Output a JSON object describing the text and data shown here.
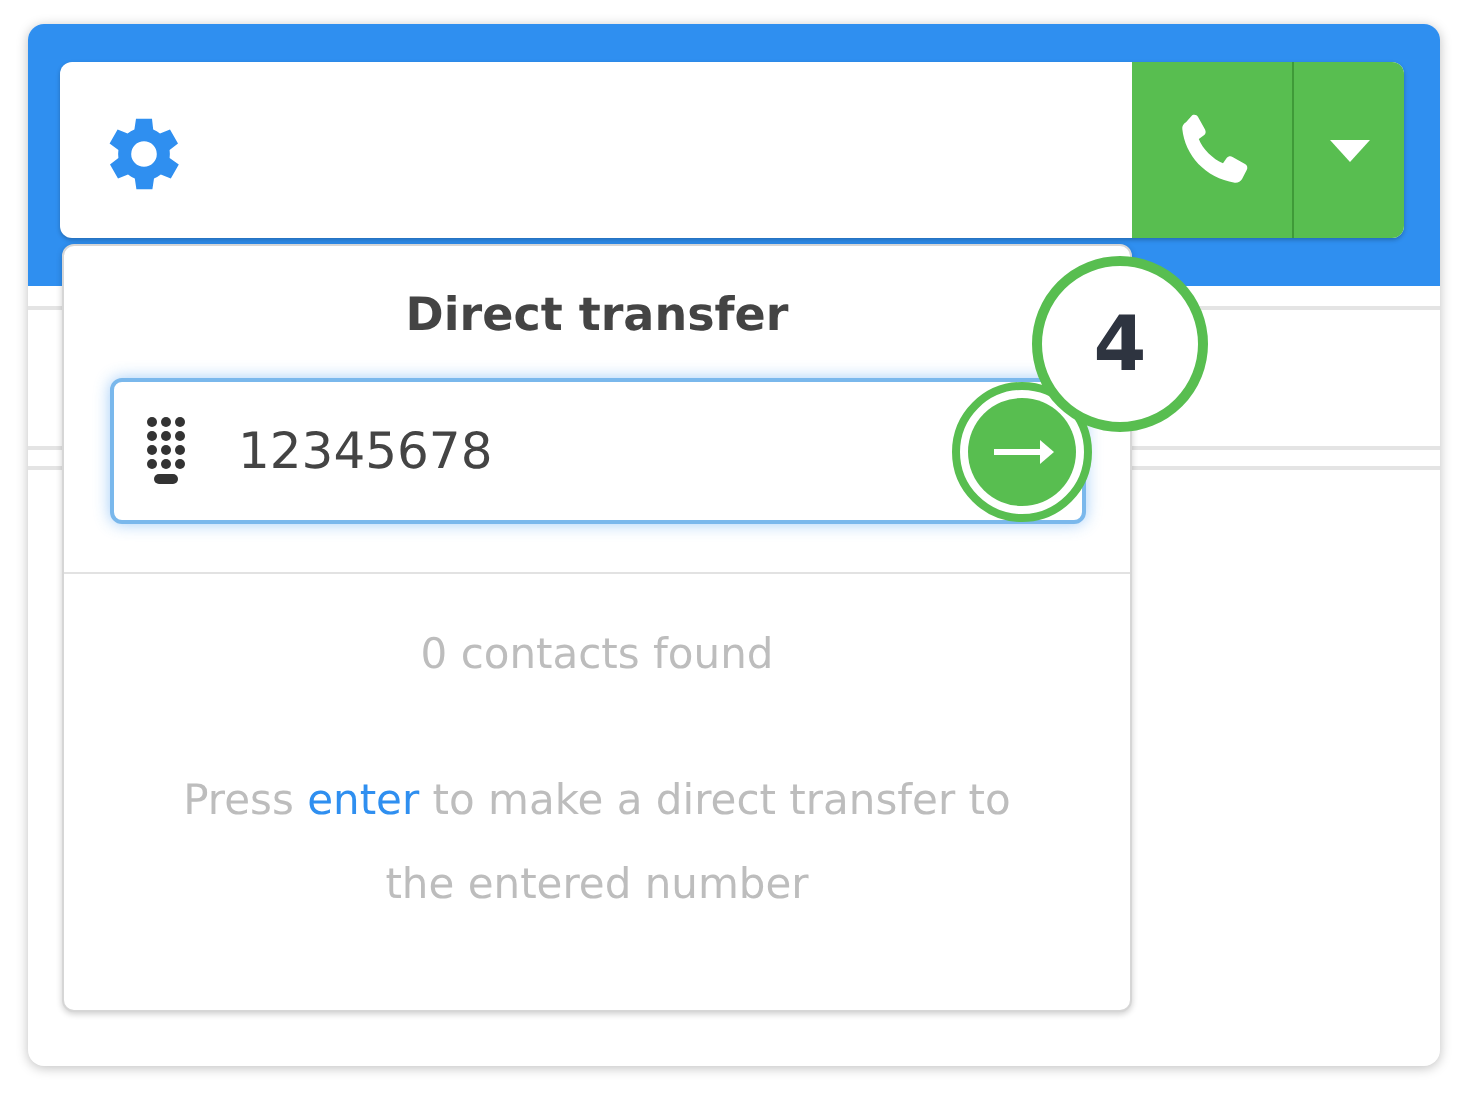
{
  "popup": {
    "title": "Direct transfer",
    "input": {
      "value": "12345678"
    },
    "result": "0 contacts found",
    "help": {
      "before": "Press ",
      "link": "enter",
      "after": " to make a direct transfer to the entered number"
    }
  },
  "callout": {
    "label": "4"
  }
}
